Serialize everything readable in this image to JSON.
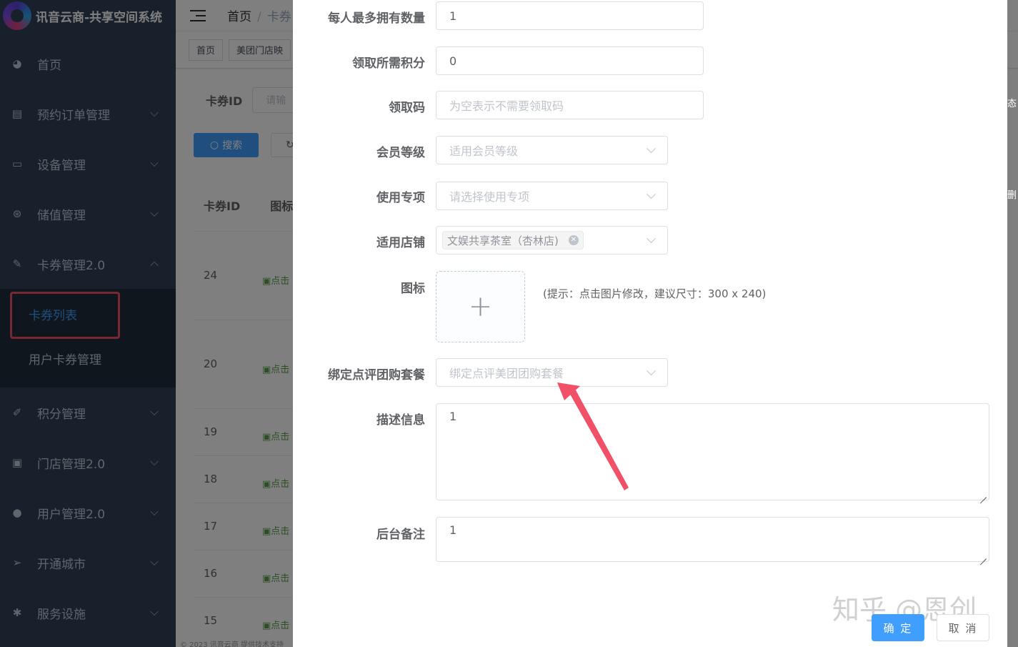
{
  "app": {
    "title": "讯音云商-共享空间系统"
  },
  "sidebar": {
    "items": [
      {
        "label": "首页",
        "icon": "dashboard-icon"
      },
      {
        "label": "预约订单管理",
        "icon": "document-icon"
      },
      {
        "label": "设备管理",
        "icon": "calendar-icon"
      },
      {
        "label": "储值管理",
        "icon": "wallet-icon"
      },
      {
        "label": "卡券管理2.0",
        "icon": "coupon-icon"
      },
      {
        "label": "积分管理",
        "icon": "edit-icon"
      },
      {
        "label": "门店管理2.0",
        "icon": "store-icon"
      },
      {
        "label": "用户管理2.0",
        "icon": "user-icon"
      },
      {
        "label": "开通城市",
        "icon": "send-icon"
      },
      {
        "label": "服务设施",
        "icon": "gear-icon"
      }
    ],
    "submenu": [
      {
        "label": "卡券列表"
      },
      {
        "label": "用户卡券管理"
      }
    ]
  },
  "navbar": {
    "home": "首页",
    "current": "卡券"
  },
  "tags": [
    "首页",
    "美团门店映"
  ],
  "filter": {
    "label": "卡券ID",
    "placeholder": "请输"
  },
  "buttons": {
    "search": "搜索"
  },
  "table": {
    "headers": [
      "卡券ID",
      "图标"
    ],
    "rows": [
      {
        "id": "24",
        "img": "点击"
      },
      {
        "id": "20",
        "img": "点击"
      },
      {
        "id": "19",
        "img": "点击"
      },
      {
        "id": "18",
        "img": "点击"
      },
      {
        "id": "17",
        "img": "点击"
      },
      {
        "id": "16",
        "img": "点击"
      },
      {
        "id": "15",
        "img": "点击"
      }
    ]
  },
  "footer": "© 2023 讯音云商 提供技术支持",
  "right_edge": {
    "status": "态",
    "delete": "删"
  },
  "form": {
    "max_per_person": {
      "label": "每人最多拥有数量",
      "value": "1"
    },
    "points": {
      "label": "领取所需积分",
      "value": "0"
    },
    "claim_code": {
      "label": "领取码",
      "placeholder": "为空表示不需要领取码"
    },
    "member_level": {
      "label": "会员等级",
      "placeholder": "适用会员等级"
    },
    "usage": {
      "label": "使用专项",
      "placeholder": "请选择使用专项"
    },
    "stores": {
      "label": "适用店铺",
      "chip": "文娱共享茶室（杏林店)"
    },
    "icon": {
      "label": "图标",
      "hint": "(提示：点击图片修改，建议尺寸：300 x 240)"
    },
    "package": {
      "label": "绑定点评团购套餐",
      "placeholder": "绑定点评美团团购套餐"
    },
    "description": {
      "label": "描述信息",
      "value": "1"
    },
    "remark": {
      "label": "后台备注",
      "value": "1"
    },
    "confirm": "确 定",
    "cancel": "取 消"
  },
  "watermark": "知乎 @恩创",
  "colors": {
    "sidebar_bg": "#304156",
    "primary": "#409eff",
    "highlight": "#f05167"
  }
}
